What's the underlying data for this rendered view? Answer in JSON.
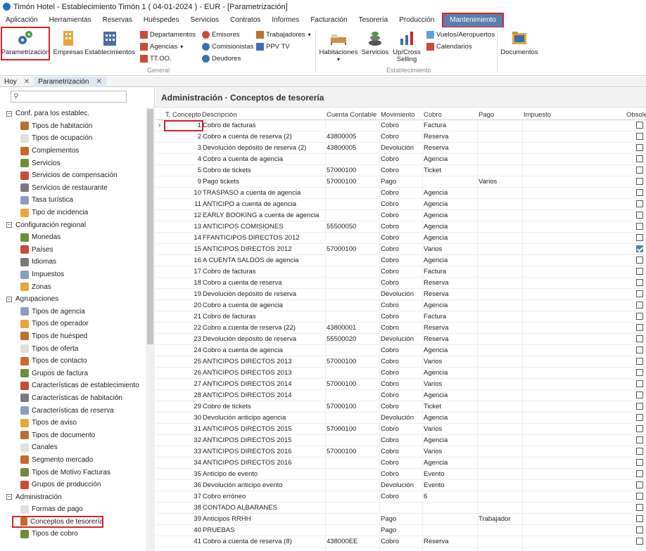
{
  "window": {
    "title": "Timón Hotel - Establecimiento Timón 1 ( 04-01-2024 ) - EUR - [Parametrización]"
  },
  "menu": [
    "Aplicación",
    "Herramientas",
    "Reservas",
    "Huéspedes",
    "Servicios",
    "Contratos",
    "Informes",
    "Facturación",
    "Tesorería",
    "Producción",
    "Mantenimiento"
  ],
  "ribbon": {
    "parametrizacion": "Parametrización",
    "empresas": "Empresas",
    "establecimientos": "Establecimientos",
    "departamentos": "Departamentos",
    "agencias": "Agencias",
    "ttoo": "TT.OO.",
    "emisores": "Emisores",
    "comisionistas": "Comisionistas",
    "deudores": "Deudores",
    "trabajadores": "Trabajadores",
    "ppvtv": "PPV TV",
    "group_general": "General",
    "habitaciones": "Habitaciones",
    "servicios": "Servicios",
    "upcross_1": "Up/Cross",
    "upcross_2": "Selling",
    "vuelos": "Vuelos/Aeropuertos",
    "calendarios": "Calendarios",
    "group_establecimiento": "Establecimiento",
    "documentos": "Documentos"
  },
  "tabs": {
    "hoy": "Hoy",
    "param": "Parametrización"
  },
  "left": {
    "search_placeholder": "",
    "sections": [
      {
        "label": "Conf. para los establec.",
        "items": [
          "Tipos de habitación",
          "Tipos de ocupación",
          "Complementos",
          "Servicios",
          "Servicios de compensación",
          "Servicios de restaurante",
          "Tasa turística",
          "Tipo de incidencia"
        ]
      },
      {
        "label": "Configuración regional",
        "items": [
          "Monedas",
          "Países",
          "Idiomas",
          "Impuestos",
          "Zonas"
        ]
      },
      {
        "label": "Agrupaciones",
        "items": [
          "Tipos de agencia",
          "Tipos de operador",
          "Tipos de huésped",
          "Tipos de oferta",
          "Tipos de contacto",
          "Grupos de factura",
          "Características de establecimiento",
          "Características de habitación",
          "Características de reserva",
          "Tipos de aviso",
          "Tipos de documento",
          "Canales",
          "Segmento mercado",
          "Tipos de Motivo Facturas",
          "Grupos de producción"
        ]
      },
      {
        "label": "Administración",
        "items": [
          "Formas de pago",
          "Conceptos de tesorería",
          "Tipos de cobro"
        ]
      }
    ]
  },
  "main": {
    "title": "Administración · Conceptos de tesorería",
    "columns": {
      "tconcepto": "T. Concepto",
      "descripcion": "Descripción",
      "cuenta": "Cuenta Contable",
      "movimiento": "Movimiento",
      "cobro": "Cobro",
      "pago": "Pago",
      "impuesto": "Impuesto",
      "obsoleto": "Obsole"
    },
    "rows": [
      {
        "n": "1",
        "d": "Cobro de facturas",
        "c": "",
        "m": "Cobro",
        "co": "Factura",
        "p": "",
        "o": false
      },
      {
        "n": "2",
        "d": "Cobro a cuenta de reserva (2)",
        "c": "43800005",
        "m": "Cobro",
        "co": "Reserva",
        "p": "",
        "o": false
      },
      {
        "n": "3",
        "d": "Devolución depósito de reserva (2)",
        "c": "43800005",
        "m": "Devolución",
        "co": "Reserva",
        "p": "",
        "o": false
      },
      {
        "n": "4",
        "d": "Cobro a cuenta de agencia",
        "c": "",
        "m": "Cobro",
        "co": "Agencia",
        "p": "",
        "o": false
      },
      {
        "n": "5",
        "d": "Cobro de tickets",
        "c": "57000100",
        "m": "Cobro",
        "co": "Ticket",
        "p": "",
        "o": false
      },
      {
        "n": "9",
        "d": "Pago tickets",
        "c": "57000100",
        "m": "Pago",
        "co": "",
        "p": "Varios",
        "o": false
      },
      {
        "n": "10",
        "d": "TRASPASO a cuenta de agencia",
        "c": "",
        "m": "Cobro",
        "co": "Agencia",
        "p": "",
        "o": false
      },
      {
        "n": "11",
        "d": "ANTICIPO a cuenta de agencia",
        "c": "",
        "m": "Cobro",
        "co": "Agencia",
        "p": "",
        "o": false
      },
      {
        "n": "12",
        "d": "EARLY BOOKING a cuenta de agencia",
        "c": "",
        "m": "Cobro",
        "co": "Agencia",
        "p": "",
        "o": false
      },
      {
        "n": "13",
        "d": "ANTICIPOS COMISIONES",
        "c": "55500050",
        "m": "Cobro",
        "co": "Agencia",
        "p": "",
        "o": false
      },
      {
        "n": "14",
        "d": "FFANTICIPOS DIRECTOS 2012",
        "c": "",
        "m": "Cobro",
        "co": "Agencia",
        "p": "",
        "o": false
      },
      {
        "n": "15",
        "d": "ANTICIPOS DIRECTOS 2012",
        "c": "57000100",
        "m": "Cobro",
        "co": "Varios",
        "p": "",
        "o": true
      },
      {
        "n": "16",
        "d": "A CUENTA SALDOS de agencia",
        "c": "",
        "m": "Cobro",
        "co": "Agencia",
        "p": "",
        "o": false
      },
      {
        "n": "17",
        "d": "Cobro de facturas",
        "c": "",
        "m": "Cobro",
        "co": "Factura",
        "p": "",
        "o": false
      },
      {
        "n": "18",
        "d": "Cobro a cuenta de reserva",
        "c": "",
        "m": "Cobro",
        "co": "Reserva",
        "p": "",
        "o": false
      },
      {
        "n": "19",
        "d": "Devolución depósito de reserva",
        "c": "",
        "m": "Devolución",
        "co": "Reserva",
        "p": "",
        "o": false
      },
      {
        "n": "20",
        "d": "Cobro a cuenta de agencia",
        "c": "",
        "m": "Cobro",
        "co": "Agencia",
        "p": "",
        "o": false
      },
      {
        "n": "21",
        "d": "Cobro de facturas",
        "c": "",
        "m": "Cobro",
        "co": "Factura",
        "p": "",
        "o": false
      },
      {
        "n": "22",
        "d": "Cobro a cuenta de reserva (22)",
        "c": "43800001",
        "m": "Cobro",
        "co": "Reserva",
        "p": "",
        "o": false
      },
      {
        "n": "23",
        "d": "Devolución depósito de reserva",
        "c": "55500020",
        "m": "Devolución",
        "co": "Reserva",
        "p": "",
        "o": false
      },
      {
        "n": "24",
        "d": "Cobro a cuenta de agencia",
        "c": "",
        "m": "Cobro",
        "co": "Agencia",
        "p": "",
        "o": false
      },
      {
        "n": "25",
        "d": "ANTICIPOS DIRECTOS 2013",
        "c": "57000100",
        "m": "Cobro",
        "co": "Varios",
        "p": "",
        "o": false
      },
      {
        "n": "26",
        "d": "ANTICIPOS DIRECTOS 2013",
        "c": "",
        "m": "Cobro",
        "co": "Agencia",
        "p": "",
        "o": false
      },
      {
        "n": "27",
        "d": "ANTICIPOS DIRECTOS 2014",
        "c": "57000100",
        "m": "Cobro",
        "co": "Varios",
        "p": "",
        "o": false
      },
      {
        "n": "28",
        "d": "ANTICIPOS DIRECTOS 2014",
        "c": "",
        "m": "Cobro",
        "co": "Agencia",
        "p": "",
        "o": false
      },
      {
        "n": "29",
        "d": "Cobro de tickets",
        "c": "57000100",
        "m": "Cobro",
        "co": "Ticket",
        "p": "",
        "o": false
      },
      {
        "n": "30",
        "d": "Devolución anticipo agencia",
        "c": "",
        "m": "Devolución",
        "co": "Agencia",
        "p": "",
        "o": false
      },
      {
        "n": "31",
        "d": "ANTICIPOS DIRECTOS 2015",
        "c": "57000100",
        "m": "Cobro",
        "co": "Varios",
        "p": "",
        "o": false
      },
      {
        "n": "32",
        "d": "ANTICIPOS DIRECTOS 2015",
        "c": "",
        "m": "Cobro",
        "co": "Agencia",
        "p": "",
        "o": false
      },
      {
        "n": "33",
        "d": "ANTICIPOS DIRECTOS 2016",
        "c": "57000100",
        "m": "Cobro",
        "co": "Varios",
        "p": "",
        "o": false
      },
      {
        "n": "34",
        "d": "ANTICIPOS DIRECTOS 2016",
        "c": "",
        "m": "Cobro",
        "co": "Agencia",
        "p": "",
        "o": false
      },
      {
        "n": "35",
        "d": "Anticipo de evento",
        "c": "",
        "m": "Cobro",
        "co": "Evento",
        "p": "",
        "o": false
      },
      {
        "n": "36",
        "d": "Devolución anticipo evento",
        "c": "",
        "m": "Devolución",
        "co": "Evento",
        "p": "",
        "o": false
      },
      {
        "n": "37",
        "d": "Cobro erróneo",
        "c": "",
        "m": "Cobro",
        "co": "6",
        "p": "",
        "o": false
      },
      {
        "n": "38",
        "d": "CONTADO ALBARANES",
        "c": "",
        "m": "",
        "co": "",
        "p": "",
        "o": false
      },
      {
        "n": "39",
        "d": "Anticipos RRHH",
        "c": "",
        "m": "Pago",
        "co": "",
        "p": "Trabajador",
        "o": false
      },
      {
        "n": "40",
        "d": "PRUEBAS",
        "c": "",
        "m": "Pago",
        "co": "",
        "p": "",
        "o": false
      },
      {
        "n": "41",
        "d": "Cobro a cuenta de reserva (8)",
        "c": "438000EE",
        "m": "Cobro",
        "co": "Reserva",
        "p": "",
        "o": false
      }
    ]
  },
  "colors": {
    "accent": "#5a7fae",
    "highlight": "#d6232a"
  }
}
